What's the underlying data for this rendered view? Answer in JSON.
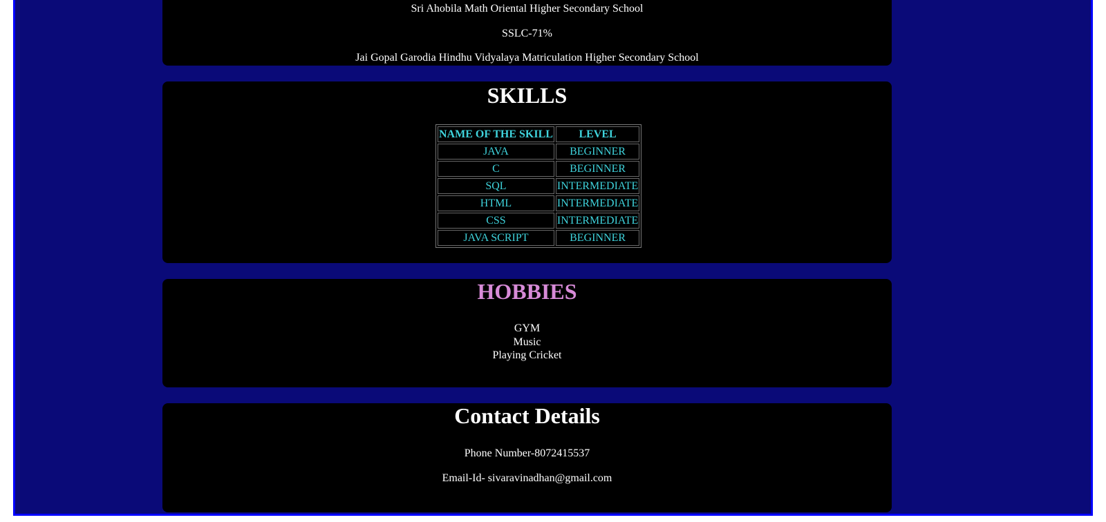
{
  "colors": {
    "page_background": "#0a0a78",
    "frame_border": "#0000ff",
    "card_background": "#000000",
    "table_text": "#3fd3dc",
    "hobbies_heading": "#d88bd8",
    "text": "#ffffff"
  },
  "education": {
    "hsc_school": "Sri Ahobila Math Oriental Higher Secondary School",
    "sslc": "SSLC-71%",
    "sslc_school": "Jai Gopal Garodia Hindhu Vidyalaya Matriculation Higher Secondary School"
  },
  "skills": {
    "heading": "SKILLS",
    "columns": [
      "NAME OF THE SKILL",
      "LEVEL"
    ],
    "rows": [
      {
        "name": "JAVA",
        "level": "BEGINNER"
      },
      {
        "name": "C",
        "level": "BEGINNER"
      },
      {
        "name": "SQL",
        "level": "INTERMEDIATE"
      },
      {
        "name": "HTML",
        "level": "INTERMEDIATE"
      },
      {
        "name": "CSS",
        "level": "INTERMEDIATE"
      },
      {
        "name": "JAVA SCRIPT",
        "level": "BEGINNER"
      }
    ]
  },
  "hobbies": {
    "heading": "HOBBIES",
    "items": [
      "GYM",
      "Music",
      "Playing Cricket"
    ]
  },
  "contact": {
    "heading": "Contact Details",
    "phone": "Phone Number-8072415537",
    "email": "Email-Id- sivaravinadhan@gmail.com"
  }
}
